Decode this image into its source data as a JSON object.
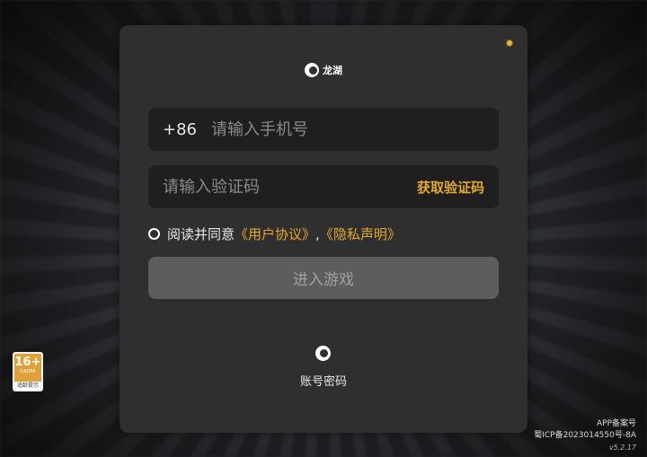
{
  "brand": {
    "name": "龙湖"
  },
  "login": {
    "phone_prefix": "+86",
    "phone_placeholder": "请输入手机号",
    "code_placeholder": "请输入验证码",
    "get_code_label": "获取验证码",
    "agree_text": "阅读并同意",
    "user_agreement": "《用户协议》",
    "separator": ",",
    "privacy_policy": "《隐私声明》",
    "enter_button": "进入游戏",
    "alt_login_label": "账号密码"
  },
  "age_rating": {
    "age": "16+",
    "org": "CADPA",
    "tip": "适龄提示"
  },
  "footer": {
    "record": "APP备案号",
    "icp": "蜀ICP备2023014550号-8A",
    "version": "v5.2.17"
  },
  "colors": {
    "accent": "#e5a82e",
    "panel": "#2f2f2f",
    "field": "#1f1f1f",
    "button_disabled": "#5d5d5d"
  }
}
